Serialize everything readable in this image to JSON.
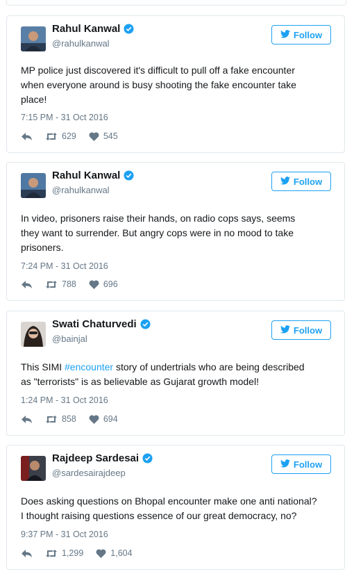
{
  "colors": {
    "accent": "#1da1f2",
    "text": "#14171a",
    "muted": "#657786",
    "border": "#e1e8ed"
  },
  "tweets": [
    {
      "name": "Rahul Kanwal",
      "handle": "@rahulkanwal",
      "follow_label": "Follow",
      "text": "MP police just discovered it's difficult to pull off a fake encounter\nwhen everyone around is busy shooting the fake encounter take\nplace!",
      "time": "7:15 PM - 31 Oct 2016",
      "retweets": "629",
      "likes": "545"
    },
    {
      "name": "Rahul Kanwal",
      "handle": "@rahulkanwal",
      "follow_label": "Follow",
      "text": "In video, prisoners raise their hands, on radio cops says, seems\nthey want to surrender. But angry cops were in no mood to take\nprisoners.",
      "time": "7:24 PM - 31 Oct 2016",
      "retweets": "788",
      "likes": "696"
    },
    {
      "name": "Swati Chaturvedi",
      "handle": "@bainjal",
      "follow_label": "Follow",
      "text_before": "This SIMI ",
      "hashtag": "#encounter",
      "text_after": " story of undertrials who are being described\nas \"terrorists\" is as believable as Gujarat growth model!",
      "time": "1:24 PM - 31 Oct 2016",
      "retweets": "858",
      "likes": "694"
    },
    {
      "name": "Rajdeep Sardesai",
      "handle": "@sardesairajdeep",
      "follow_label": "Follow",
      "text": "Does asking questions on Bhopal encounter make one anti national?\nI thought raising questions essence of our great democracy, no?",
      "time": "9:37 PM - 31 Oct 2016",
      "retweets": "1,299",
      "likes": "1,604"
    }
  ]
}
